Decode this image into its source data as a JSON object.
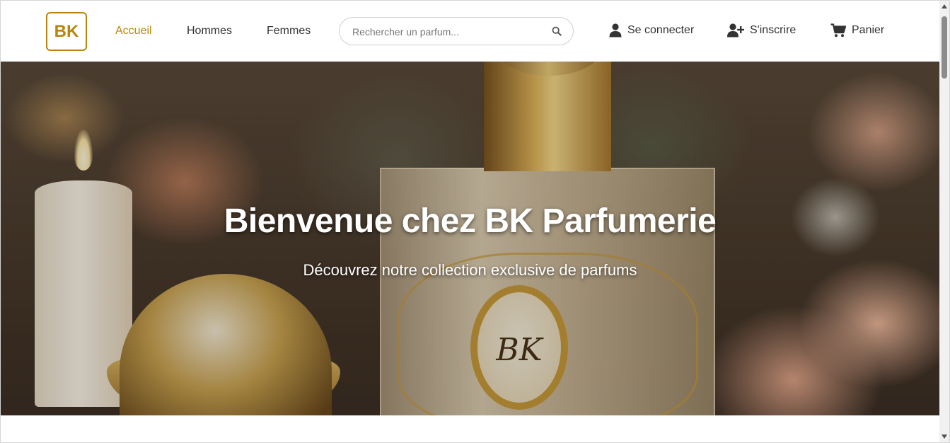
{
  "navbar": {
    "logo_text": "BK",
    "links": [
      {
        "label": "Accueil",
        "active": true
      },
      {
        "label": "Hommes",
        "active": false
      },
      {
        "label": "Femmes",
        "active": false
      }
    ],
    "search": {
      "placeholder": "Rechercher un parfum...",
      "value": "",
      "icon": "search-icon"
    },
    "actions": {
      "login": {
        "label": "Se connecter",
        "icon": "user-icon"
      },
      "register": {
        "label": "S'inscrire",
        "icon": "user-plus-icon"
      },
      "cart": {
        "label": "Panier",
        "icon": "cart-icon"
      }
    }
  },
  "hero": {
    "title": "Bienvenue chez BK Parfumerie",
    "subtitle": "Découvrez notre collection exclusive de parfums",
    "emblem_text": "BK"
  },
  "colors": {
    "accent": "#b8860b",
    "text": "#333333",
    "hero_text": "#ffffff"
  }
}
